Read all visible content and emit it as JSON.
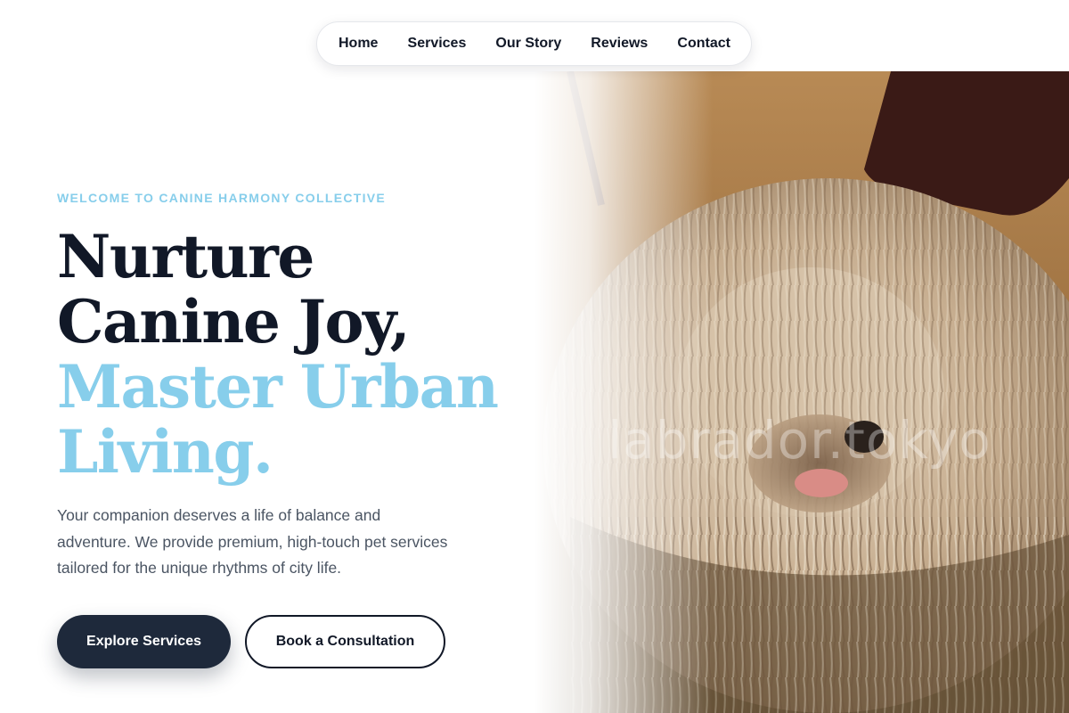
{
  "nav": {
    "items": [
      {
        "label": "Home"
      },
      {
        "label": "Services"
      },
      {
        "label": "Our Story"
      },
      {
        "label": "Reviews"
      },
      {
        "label": "Contact"
      }
    ]
  },
  "hero": {
    "eyebrow": "WELCOME TO CANINE HARMONY COLLECTIVE",
    "headline_line1": "Nurture",
    "headline_line2": "Canine Joy,",
    "headline_line3": "Master Urban",
    "headline_line4": "Living.",
    "description": "Your companion deserves a life of balance and adventure. We provide premium, high-touch pet services tailored for the unique rhythms of city life.",
    "primary_button": "Explore Services",
    "secondary_button": "Book a Consultation",
    "image_watermark": "labrador.tokyo"
  },
  "colors": {
    "accent": "#87ceeb",
    "dark": "#1e293b",
    "text": "#111827",
    "body_text": "#4b5563"
  }
}
